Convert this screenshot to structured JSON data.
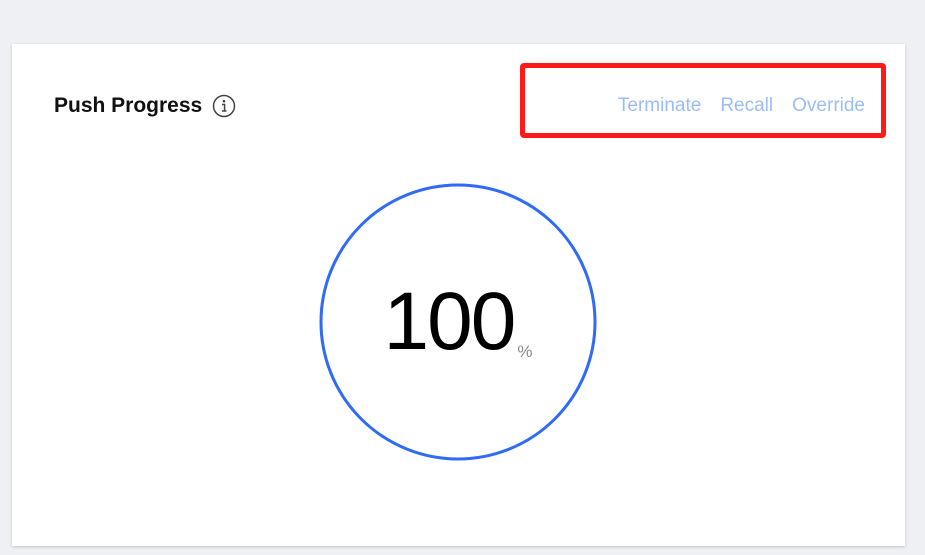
{
  "panel": {
    "title": "Push Progress",
    "info_icon": "info-circle-icon"
  },
  "actions": {
    "terminate_label": "Terminate",
    "recall_label": "Recall",
    "override_label": "Override",
    "link_color": "#9bbdf5",
    "highlight_color": "#ff1a1a"
  },
  "progress": {
    "value": "100",
    "unit": "%",
    "fraction": 1.0,
    "ring_color": "#2f6bf6"
  }
}
